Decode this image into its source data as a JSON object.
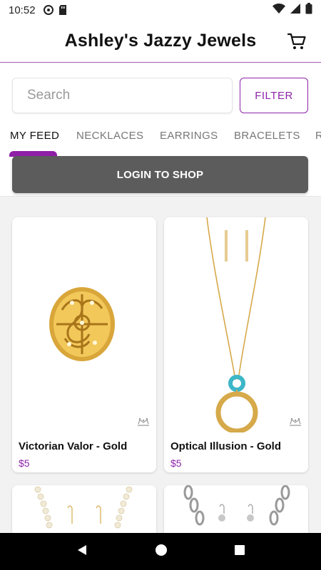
{
  "status_bar": {
    "time": "10:52"
  },
  "app_bar": {
    "title": "Ashley's Jazzy Jewels"
  },
  "search": {
    "placeholder": "Search",
    "filter_label": "FILTER"
  },
  "tabs": [
    {
      "label": "MY FEED"
    },
    {
      "label": "NECKLACES"
    },
    {
      "label": "EARRINGS"
    },
    {
      "label": "BRACELETS"
    },
    {
      "label": "R"
    }
  ],
  "login": {
    "label": "LOGIN TO SHOP"
  },
  "products": [
    {
      "name": "Victorian Valor - Gold",
      "price": "$5"
    },
    {
      "name": "Optical Illusion - Gold",
      "price": "$5"
    },
    {
      "name": "",
      "price": ""
    },
    {
      "name": "",
      "price": ""
    }
  ],
  "colors": {
    "accent": "#8e24aa",
    "login_bg": "#5c5c5c",
    "tab_indicator": "#8e1fa6"
  }
}
